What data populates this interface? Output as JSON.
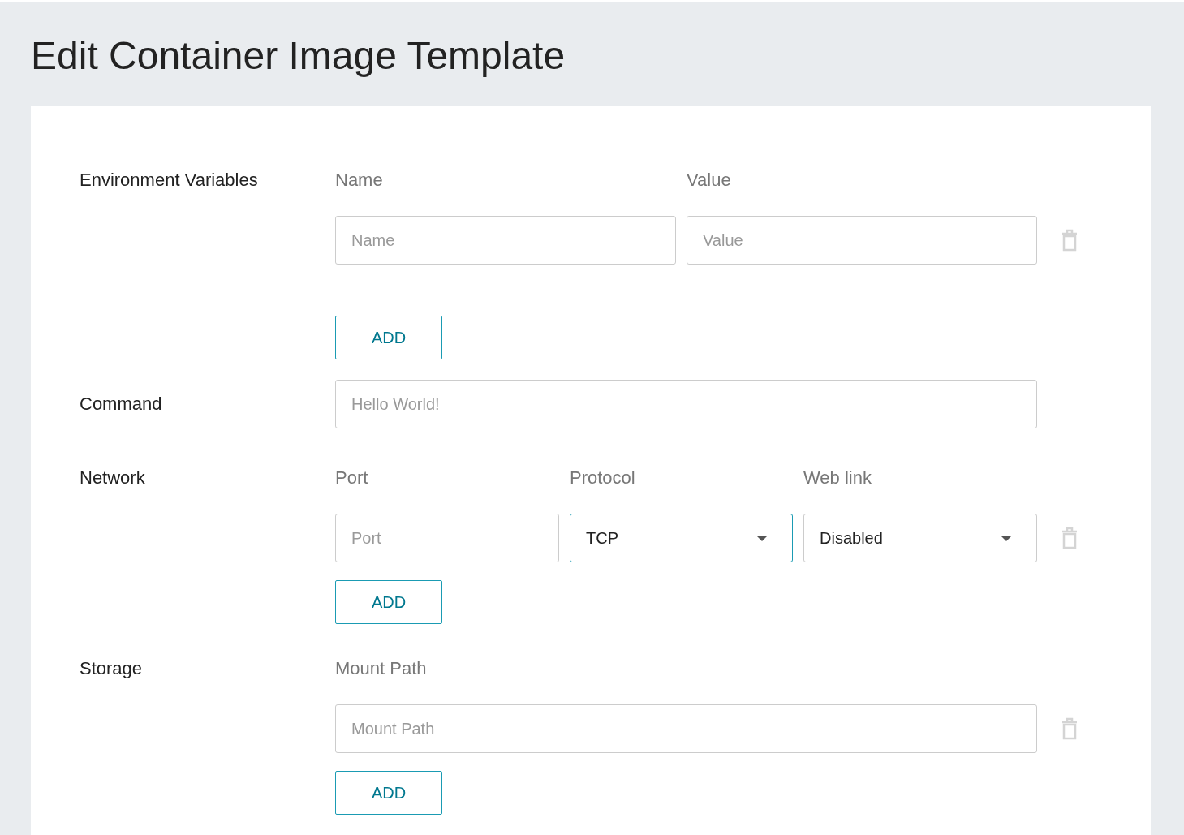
{
  "title": "Edit Container Image Template",
  "sections": [
    {
      "kind": "env",
      "label": "Environment Variables",
      "columns": [
        "Name",
        "Value"
      ],
      "rows": [
        [
          {
            "kind": "text",
            "placeholder": "Name",
            "focused": false
          },
          {
            "kind": "text",
            "placeholder": "Value",
            "focused": false
          }
        ]
      ],
      "add_button": "ADD"
    },
    {
      "kind": "command",
      "label": "Command",
      "rows": [
        [
          {
            "kind": "text",
            "placeholder": "Hello World!",
            "focused": false
          }
        ]
      ]
    },
    {
      "kind": "network",
      "label": "Network",
      "columns": [
        "Port",
        "Protocol",
        "Web link"
      ],
      "rows": [
        [
          {
            "kind": "text",
            "placeholder": "Port",
            "focused": false
          },
          {
            "kind": "select",
            "value": "TCP",
            "focused": true
          },
          {
            "kind": "select",
            "value": "Disabled",
            "focused": false
          }
        ]
      ],
      "add_button": "ADD"
    },
    {
      "kind": "storage",
      "label": "Storage",
      "columns": [
        "Mount Path"
      ],
      "rows": [
        [
          {
            "kind": "text",
            "placeholder": "Mount Path",
            "focused": false
          }
        ]
      ],
      "add_button": "ADD"
    }
  ]
}
